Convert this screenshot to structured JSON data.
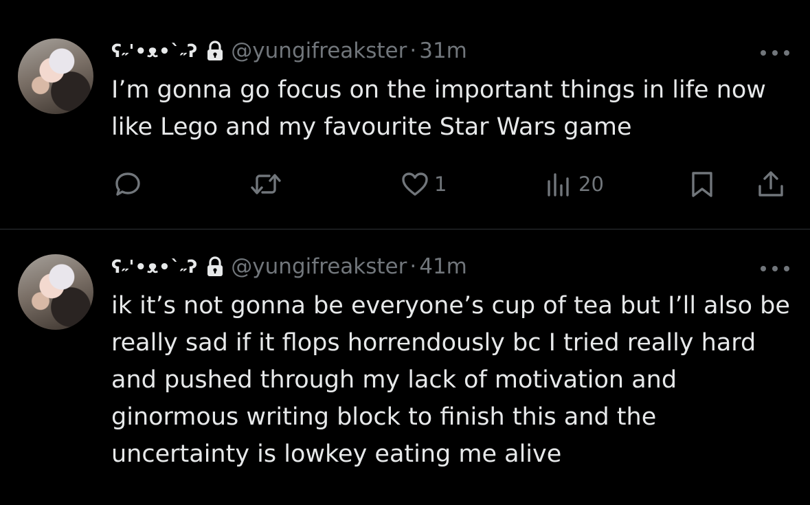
{
  "tweets": [
    {
      "display_name": "ʕ˶'•ᴥ•`˶ʔ",
      "handle": "@yungifreakster",
      "separator": "·",
      "time": "31m",
      "text": "I’m gonna go focus on the important things in life now like Lego and my favourite Star Wars game",
      "likes": "1",
      "views": "20"
    },
    {
      "display_name": "ʕ˶'•ᴥ•`˶ʔ",
      "handle": "@yungifreakster",
      "separator": "·",
      "time": "41m",
      "text": "ik it’s not gonna be everyone’s cup of tea but I’ll also be really sad if it flops horrendously bc I tried really hard and pushed through my lack of motivation and ginormous writing block to finish this and the uncertainty is lowkey eating me alive"
    }
  ],
  "icons": {
    "lock": "lock-icon",
    "more": "more-icon",
    "reply": "reply-icon",
    "retweet": "retweet-icon",
    "like": "heart-icon",
    "views": "views-icon",
    "bookmark": "bookmark-icon",
    "share": "share-icon"
  },
  "colors": {
    "background": "#000000",
    "text": "#e7e9ea",
    "muted": "#71767b",
    "divider": "#2f3336"
  }
}
